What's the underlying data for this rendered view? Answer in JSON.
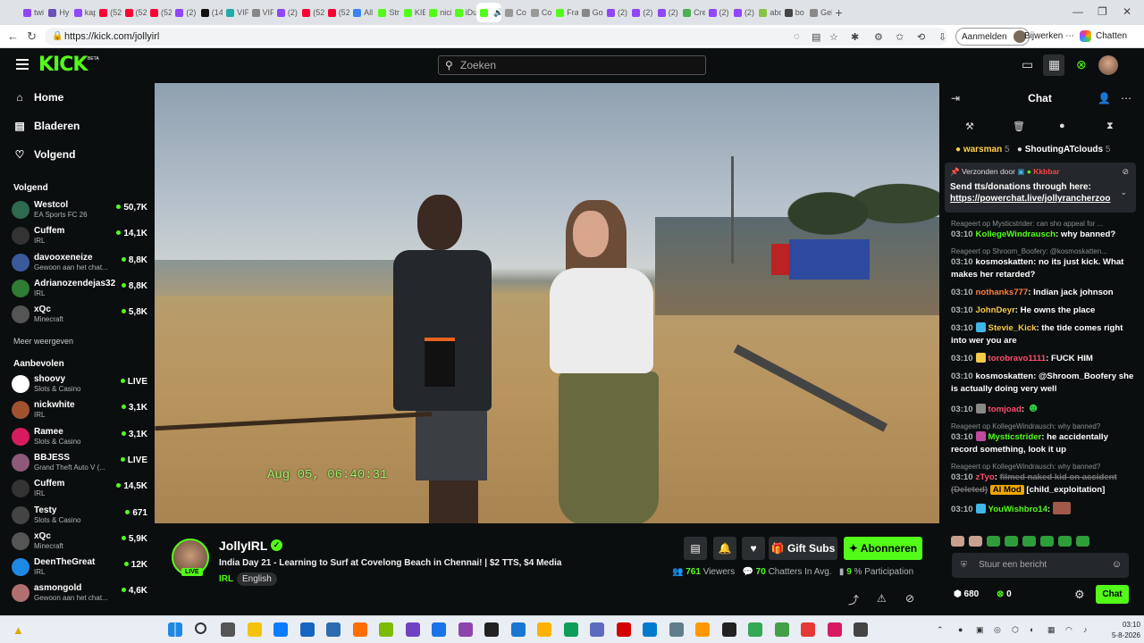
{
  "browser": {
    "tabs": [
      {
        "label": "twi",
        "color": "#9146ff"
      },
      {
        "label": "Hy",
        "color": "#6b4fbb"
      },
      {
        "label": "kap",
        "color": "#9146ff"
      },
      {
        "label": "(52",
        "color": "#ff0033"
      },
      {
        "label": "(52",
        "color": "#ff0033"
      },
      {
        "label": "(52",
        "color": "#ff0033"
      },
      {
        "label": "(2)",
        "color": "#9146ff"
      },
      {
        "label": "(14",
        "color": "#111111"
      },
      {
        "label": "VIP",
        "color": "#2aa"
      },
      {
        "label": "VIP",
        "color": "#888888"
      },
      {
        "label": "(2)",
        "color": "#9146ff"
      },
      {
        "label": "(52",
        "color": "#ff0033"
      },
      {
        "label": "(52",
        "color": "#ff0033"
      },
      {
        "label": "All",
        "color": "#3b82f6"
      },
      {
        "label": "Str",
        "color": "#53fc18"
      },
      {
        "label": "KIE",
        "color": "#53fc18"
      },
      {
        "label": "nici",
        "color": "#53fc18"
      },
      {
        "label": "iDu",
        "color": "#53fc18"
      },
      {
        "label": "",
        "color": "#53fc18"
      },
      {
        "label": "Co",
        "color": "#999999"
      },
      {
        "label": "Co",
        "color": "#999999"
      },
      {
        "label": "Fra",
        "color": "#53fc18"
      },
      {
        "label": "Go",
        "color": "#888888"
      },
      {
        "label": "(2)",
        "color": "#9146ff"
      },
      {
        "label": "(2)",
        "color": "#9146ff"
      },
      {
        "label": "(2)",
        "color": "#9146ff"
      },
      {
        "label": "Cre",
        "color": "#4caf50"
      },
      {
        "label": "(2)",
        "color": "#9146ff"
      },
      {
        "label": "(2)",
        "color": "#9146ff"
      },
      {
        "label": "abc",
        "color": "#8bc34a"
      },
      {
        "label": "bo",
        "color": "#444444"
      },
      {
        "label": "Gel",
        "color": "#888888"
      }
    ],
    "url": "https://kick.com/jollyirl",
    "login_label": "Aanmelden",
    "update_label": "Bijwerken",
    "chat_label": "Chatten"
  },
  "header": {
    "logo": "KICK",
    "beta": "BETA",
    "search_placeholder": "Zoeken"
  },
  "sidebar": {
    "nav": [
      {
        "label": "Home",
        "icon": "⌂"
      },
      {
        "label": "Bladeren",
        "icon": "▤"
      },
      {
        "label": "Volgend",
        "icon": "♡"
      }
    ],
    "following_title": "Volgend",
    "following": [
      {
        "name": "Westcol",
        "game": "EA Sports FC 26",
        "count": "50,7K",
        "color": "#2d6a4f"
      },
      {
        "name": "Cuffem",
        "game": "IRL",
        "count": "14,1K",
        "color": "#333333"
      },
      {
        "name": "davooxeneize",
        "game": "Gewoon aan het chat...",
        "count": "8,8K",
        "color": "#3a5a9a"
      },
      {
        "name": "Adrianozendejas32",
        "game": "IRL",
        "count": "8,8K",
        "color": "#2e7d32"
      },
      {
        "name": "xQc",
        "game": "Minecraft",
        "count": "5,8K",
        "color": "#555555"
      }
    ],
    "more_label": "Meer weergeven",
    "recommended_title": "Aanbevolen",
    "recommended": [
      {
        "name": "shoovy",
        "game": "Slots & Casino",
        "count": "LIVE",
        "color": "#ffffff"
      },
      {
        "name": "nickwhite",
        "game": "IRL",
        "count": "3,1K",
        "color": "#a0522d"
      },
      {
        "name": "Ramee",
        "game": "Slots & Casino",
        "count": "3,1K",
        "color": "#d81b60"
      },
      {
        "name": "BBJESS",
        "game": "Grand Theft Auto V (...",
        "count": "LIVE",
        "color": "#8e5a7a"
      },
      {
        "name": "Cuffem",
        "game": "IRL",
        "count": "14,5K",
        "color": "#333333"
      },
      {
        "name": "Testy",
        "game": "Slots & Casino",
        "count": "671",
        "color": "#444444"
      },
      {
        "name": "xQc",
        "game": "Minecraft",
        "count": "5,9K",
        "color": "#555555"
      },
      {
        "name": "DeenTheGreat",
        "game": "IRL",
        "count": "12K",
        "color": "#1e88e5"
      },
      {
        "name": "asmongold",
        "game": "Gewoon aan het chat...",
        "count": "4,6K",
        "color": "#b07070"
      }
    ]
  },
  "video": {
    "timestamp": "Aug 05, 06:40:31"
  },
  "stream": {
    "name": "JollyIRL",
    "live": "LIVE",
    "title": "India Day 21 - Learning to Surf at Covelong Beach in Chennai! | $2 TTS, $4 Media",
    "category": "IRL",
    "language": "English",
    "gift_label": "Gift Subs",
    "subscribe_label": "Abonneren",
    "viewers": "761",
    "viewers_label": "Viewers",
    "chatters": "70",
    "chatters_label": "Chatters In Avg.",
    "participation": "9",
    "participation_label": "% Participation"
  },
  "chat": {
    "title": "Chat",
    "gifter1": {
      "name": "warsman",
      "count": "5"
    },
    "gifter2": {
      "name": "ShoutingATclouds",
      "count": "5"
    },
    "pinned": {
      "by_label": "Verzonden door",
      "by_user": "Kkbbar",
      "text": "Send tts/donations through here:",
      "link": "https://powerchat.live/jollyrancherzoo"
    },
    "messages": [
      {
        "reply": "Reageert op Mysticstrider: can sho appeal for ...",
        "time": "03:10",
        "user": "KollegeWindrausch",
        "color": "#53fc18",
        "badge": "",
        "text": "why banned?"
      },
      {
        "reply": "Reageert op Shroom_Boofery: @kosmoskatten...",
        "time": "03:10",
        "user": "kosmoskatten",
        "color": "#ffffff",
        "badge": "",
        "text": "no its just kick. What makes her retarded?"
      },
      {
        "reply": "",
        "time": "03:10",
        "user": "nothanks777",
        "color": "#ff7f3f",
        "badge": "",
        "text": "Indian jack johnson"
      },
      {
        "reply": "",
        "time": "03:10",
        "user": "JohnDeyr",
        "color": "#f7c948",
        "badge": "",
        "text": "He owns the place"
      },
      {
        "reply": "",
        "time": "03:10",
        "user": "Stevie_Kick",
        "color": "#f7c948",
        "badge": "#3fb7e6",
        "text": "the tide comes right into wer you are"
      },
      {
        "reply": "",
        "time": "03:10",
        "user": "torobravo1111",
        "color": "#ff4d6d",
        "badge": "#f7c948",
        "text": "FUCK HIM"
      },
      {
        "reply": "",
        "time": "03:10",
        "user": "kosmoskatten",
        "color": "#ffffff",
        "badge": "",
        "text": "@Shroom_Boofery she is actually doing very well"
      },
      {
        "reply": "",
        "time": "03:10",
        "user": "tomjoad",
        "color": "#ff4d6d",
        "badge": "#888888",
        "text": "☻"
      },
      {
        "reply": "Reageert op KollegeWindrausch: why banned?",
        "time": "03:10",
        "user": "Mysticstrider",
        "color": "#53fc18",
        "badge": "#c04aa0",
        "text": "he accidentally record something, look it up"
      },
      {
        "reply": "Reageert op KollegeWindrausch: why banned?",
        "time": "03:10",
        "user": "zTyo",
        "color": "#ff4d6d",
        "badge": "",
        "deleted": "filmed naked kid on accident (Deleted)",
        "mod": "AI Mod",
        "text": "[child_exploitation]"
      },
      {
        "reply": "",
        "time": "03:10",
        "user": "YouWishbro14",
        "color": "#53fc18",
        "badge": "#3fb7e6",
        "text": ""
      }
    ],
    "input_placeholder": "Stuur een bericht",
    "points": "680",
    "kick_points": "0",
    "send_label": "Chat"
  },
  "taskbar": {
    "time": "03:10",
    "date": "5-8-2026",
    "apps": [
      "#1e88e5",
      "#333333",
      "#555555",
      "#f4c20d",
      "#0a7cff",
      "#1565c0",
      "#2b6cb0",
      "#ff6d00",
      "#7cbb00",
      "#6f42c1",
      "#1a73e8",
      "#8e44ad",
      "#222222",
      "#1976d2",
      "#ffb300",
      "#0f9d58",
      "#5c6bc0",
      "#d50000",
      "#007acc",
      "#607d8b",
      "#ff9800",
      "#222222",
      "#34a853",
      "#43a047",
      "#e53935",
      "#d81b60",
      "#444444"
    ]
  }
}
